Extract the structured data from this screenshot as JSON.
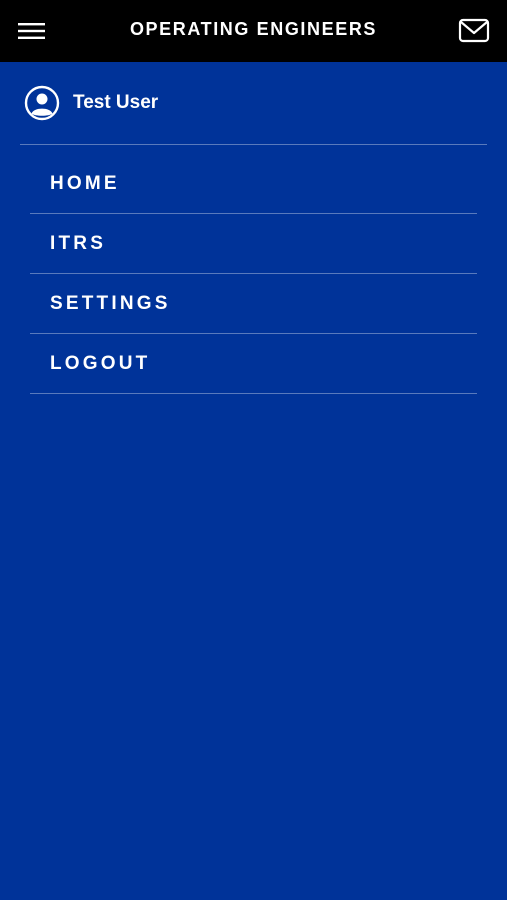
{
  "colors": {
    "topbar_bg": "#000000",
    "drawer_bg": "#003399",
    "text": "#ffffff"
  },
  "header": {
    "title": "OPERATING ENGINEERS",
    "menu_icon": "hamburger-menu-icon",
    "mail_icon": "mail-icon"
  },
  "drawer": {
    "user": {
      "name": "Test User",
      "icon": "user-avatar-icon"
    },
    "items": [
      {
        "label": "HOME"
      },
      {
        "label": "ITRS"
      },
      {
        "label": "SETTINGS"
      },
      {
        "label": "LOGOUT"
      }
    ]
  }
}
